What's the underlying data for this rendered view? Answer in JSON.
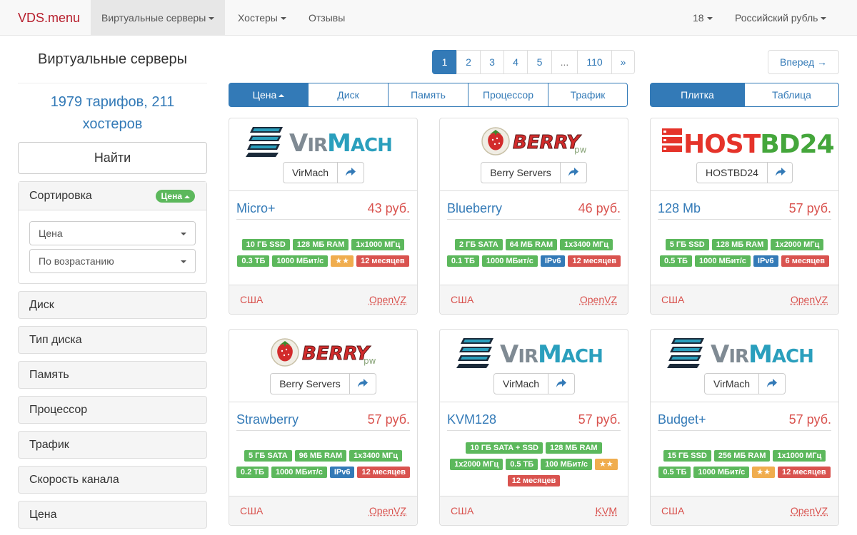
{
  "navbar": {
    "brand": "VDS.menu",
    "items": [
      "Виртуальные серверы",
      "Хостеры",
      "Отзывы"
    ],
    "per_page": "18",
    "currency": "Российский рубль"
  },
  "sidebar": {
    "title": "Виртуальные серверы",
    "count_line1": "1979 тарифов, 211",
    "count_line2": "хостеров",
    "find_button": "Найти",
    "sort": {
      "title": "Сортировка",
      "badge": "Цена",
      "field": "Цена",
      "order": "По возрастанию"
    },
    "filters": [
      "Диск",
      "Тип диска",
      "Память",
      "Процессор",
      "Трафик",
      "Скорость канала",
      "Цена"
    ]
  },
  "pagination": {
    "pages": [
      "1",
      "2",
      "3",
      "4",
      "5",
      "...",
      "110",
      "»"
    ],
    "active": "1",
    "next": "Вперед →"
  },
  "sort_tabs": [
    "Цена",
    "Диск",
    "Память",
    "Процессор",
    "Трафик"
  ],
  "view_tabs": [
    "Плитка",
    "Таблица"
  ],
  "colors": {
    "green": "#5cb85c",
    "blue": "#337ab7",
    "red": "#d9534f",
    "orange": "#f0ad4e"
  },
  "logos": {
    "virmach": "VirMach",
    "berry": "BERRY",
    "berry_suffix": "pw",
    "hostbd": "HOST",
    "hostbd_suffix": "BD24"
  },
  "cards": [
    {
      "logo": "virmach",
      "hoster": "VirMach",
      "plan": "Micro+",
      "price": "43 руб.",
      "badges": [
        [
          [
            "10 ГБ SSD",
            "green"
          ],
          [
            "128 МБ RAM",
            "green"
          ],
          [
            "1x1000 МГц",
            "green"
          ]
        ],
        [
          [
            "0.3 ТБ",
            "green"
          ],
          [
            "1000 МБит/с",
            "green"
          ],
          [
            "★★",
            "orange"
          ],
          [
            "12 месяцев",
            "red"
          ]
        ]
      ],
      "country": "США",
      "virt": "OpenVZ"
    },
    {
      "logo": "berry",
      "hoster": "Berry Servers",
      "plan": "Blueberry",
      "price": "46 руб.",
      "badges": [
        [
          [
            "2 ГБ SATA",
            "green"
          ],
          [
            "64 МБ RAM",
            "green"
          ],
          [
            "1x3400 МГц",
            "green"
          ]
        ],
        [
          [
            "0.1 ТБ",
            "green"
          ],
          [
            "1000 МБит/с",
            "green"
          ],
          [
            "IPv6",
            "blue"
          ],
          [
            "12 месяцев",
            "red"
          ]
        ]
      ],
      "country": "США",
      "virt": "OpenVZ"
    },
    {
      "logo": "hostbd",
      "hoster": "HOSTBD24",
      "plan": "128 Mb",
      "price": "57 руб.",
      "badges": [
        [
          [
            "5 ГБ SSD",
            "green"
          ],
          [
            "128 МБ RAM",
            "green"
          ],
          [
            "1x2000 МГц",
            "green"
          ]
        ],
        [
          [
            "0.5 ТБ",
            "green"
          ],
          [
            "1000 МБит/с",
            "green"
          ],
          [
            "IPv6",
            "blue"
          ],
          [
            "6 месяцев",
            "red"
          ]
        ]
      ],
      "country": "США",
      "virt": "OpenVZ"
    },
    {
      "logo": "berry",
      "hoster": "Berry Servers",
      "plan": "Strawberry",
      "price": "57 руб.",
      "badges": [
        [
          [
            "5 ГБ SATA",
            "green"
          ],
          [
            "96 МБ RAM",
            "green"
          ],
          [
            "1x3400 МГц",
            "green"
          ]
        ],
        [
          [
            "0.2 ТБ",
            "green"
          ],
          [
            "1000 МБит/с",
            "green"
          ],
          [
            "IPv6",
            "blue"
          ],
          [
            "12 месяцев",
            "red"
          ]
        ]
      ],
      "country": "США",
      "virt": "OpenVZ"
    },
    {
      "logo": "virmach",
      "hoster": "VirMach",
      "plan": "KVM128",
      "price": "57 руб.",
      "badges": [
        [
          [
            "10 ГБ SATA + SSD",
            "green"
          ],
          [
            "128 МБ RAM",
            "green"
          ]
        ],
        [
          [
            "1x2000 МГц",
            "green"
          ],
          [
            "0.5 ТБ",
            "green"
          ],
          [
            "100 МБит/с",
            "green"
          ],
          [
            "★★",
            "orange"
          ]
        ],
        [
          [
            "12 месяцев",
            "red"
          ]
        ]
      ],
      "country": "США",
      "virt": "KVM"
    },
    {
      "logo": "virmach",
      "hoster": "VirMach",
      "plan": "Budget+",
      "price": "57 руб.",
      "badges": [
        [
          [
            "15 ГБ SSD",
            "green"
          ],
          [
            "256 МБ RAM",
            "green"
          ],
          [
            "1x1000 МГц",
            "green"
          ]
        ],
        [
          [
            "0.5 ТБ",
            "green"
          ],
          [
            "1000 МБит/с",
            "green"
          ],
          [
            "★★",
            "orange"
          ],
          [
            "12 месяцев",
            "red"
          ]
        ]
      ],
      "country": "США",
      "virt": "OpenVZ"
    }
  ]
}
